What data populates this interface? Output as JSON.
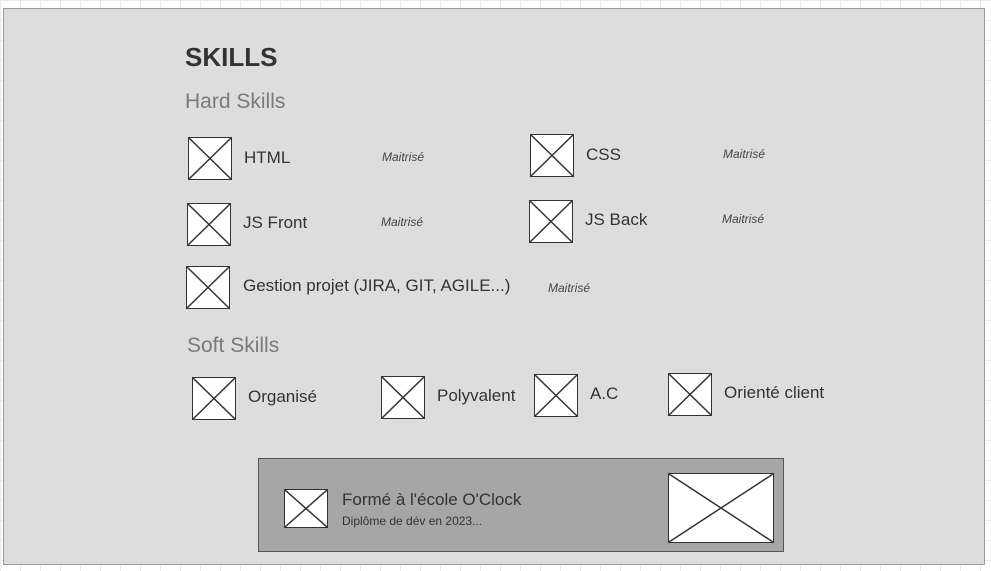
{
  "section": {
    "title": "SKILLS",
    "hard_heading": "Hard Skills",
    "soft_heading": "Soft Skills"
  },
  "hard_skills": [
    {
      "name": "HTML",
      "level": "Maitrisé",
      "icon": "image-placeholder"
    },
    {
      "name": "CSS",
      "level": "Maitrisé",
      "icon": "image-placeholder"
    },
    {
      "name": "JS Front",
      "level": "Maitrisé",
      "icon": "image-placeholder"
    },
    {
      "name": "JS Back",
      "level": "Maitrisé",
      "icon": "image-placeholder"
    },
    {
      "name": "Gestion projet (JIRA, GIT, AGILE...)",
      "level": "Maitrisé",
      "icon": "image-placeholder"
    }
  ],
  "soft_skills": [
    {
      "name": "Organisé",
      "icon": "image-placeholder"
    },
    {
      "name": "Polyvalent",
      "icon": "image-placeholder"
    },
    {
      "name": "A.C",
      "icon": "image-placeholder"
    },
    {
      "name": "Orienté client",
      "icon": "image-placeholder"
    }
  ],
  "training": {
    "title": "Formé à l'école O'Clock",
    "subtitle": "Diplôme de dév en 2023...",
    "icon": "image-placeholder"
  },
  "colors": {
    "canvas": "#dddddd",
    "banner": "#a6a6a6",
    "text": "#333333",
    "subheading": "#7a7a7a"
  }
}
